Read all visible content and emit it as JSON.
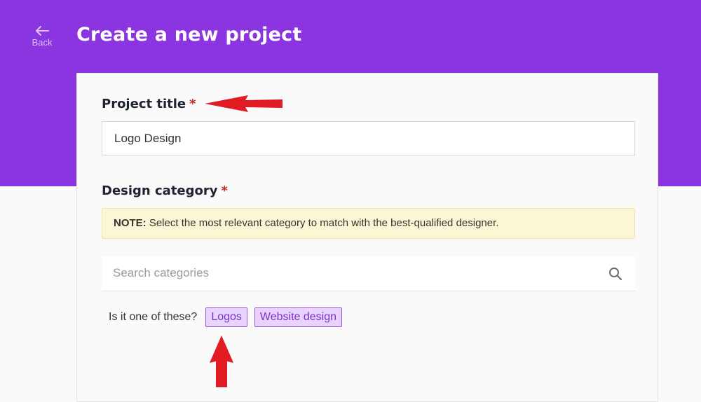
{
  "header": {
    "back_label": "Back",
    "title": "Create a new project"
  },
  "form": {
    "project_title": {
      "label": "Project title",
      "required_mark": "*",
      "value": "Logo Design"
    },
    "design_category": {
      "label": "Design category",
      "required_mark": "*",
      "note_prefix": "NOTE:",
      "note_text": " Select the most relevant category to match with the best-qualified designer.",
      "search_placeholder": "Search categories",
      "suggestion_prompt": "Is it one of these?",
      "suggestions": [
        "Logos",
        "Website design"
      ]
    }
  },
  "icons": {
    "back": "arrow-left-icon",
    "search": "search-icon"
  },
  "colors": {
    "header_bg": "#8a35e0",
    "required": "#c62828",
    "chip_bg": "#e9d2fb",
    "chip_border": "#9b57da",
    "chip_text": "#7a35c8",
    "note_bg": "#fbf6d4",
    "annotation_arrow": "#e01b24"
  }
}
